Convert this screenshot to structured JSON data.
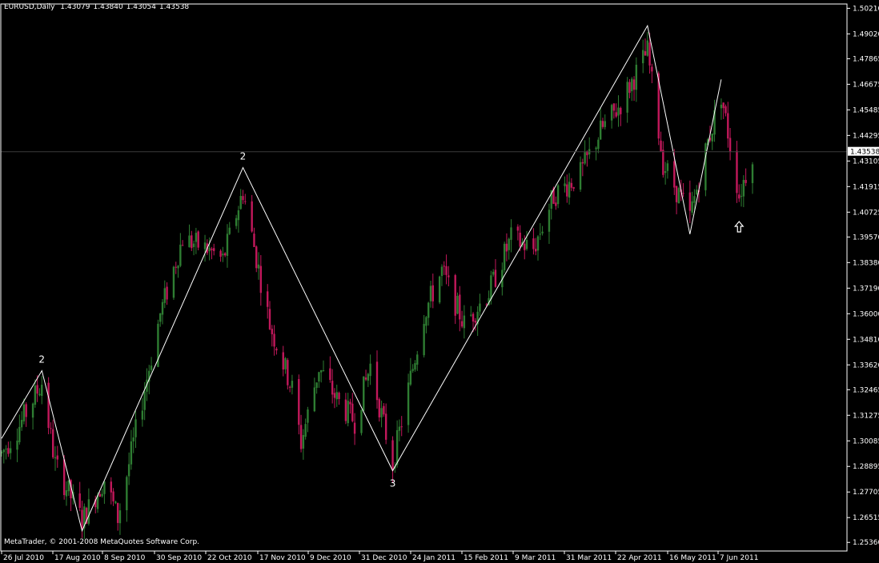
{
  "header": {
    "symbol": "EURUSD,Daily",
    "open": "1.43079",
    "high": "1.43840",
    "low": "1.43054",
    "close": "1.43538"
  },
  "copyright": "MetaTrader, © 2001-2008 MetaQuotes Software Corp.",
  "colors": {
    "background": "#000000",
    "frame": "#ffffff",
    "bull_candle": "#2e7d32",
    "bear_candle": "#c2185b",
    "wave_line": "#ffffff",
    "price_label_bg": "#ffffff"
  },
  "chart_data": {
    "type": "candlestick",
    "title": "",
    "xlabel": "",
    "ylabel": "",
    "ylim": [
      1.2496,
      1.5041
    ],
    "grid": false,
    "y_ticks": [
      "1.50210",
      "1.49020",
      "1.47865",
      "1.46675",
      "1.45485",
      "1.44295",
      "1.43105",
      "1.41915",
      "1.40725",
      "1.39570",
      "1.38380",
      "1.37190",
      "1.36000",
      "1.34810",
      "1.33620",
      "1.32465",
      "1.31275",
      "1.30085",
      "1.28895",
      "1.27705",
      "1.26515",
      "1.25360"
    ],
    "x_ticks": [
      "26 Jul 2010",
      "17 Aug 2010",
      "8 Sep 2010",
      "30 Sep 2010",
      "22 Oct 2010",
      "17 Nov 2010",
      "9 Dec 2010",
      "31 Dec 2010",
      "24 Jan 2011",
      "15 Feb 2011",
      "9 Mar 2011",
      "31 Mar 2011",
      "22 Apr 2011",
      "16 May 2011",
      "7 Jun 2011"
    ],
    "current_price": "1.43538",
    "wave_points": [
      {
        "date": "2010-07-19",
        "price": 1.302
      },
      {
        "date": "2010-08-06",
        "price": 1.3335,
        "label": "2"
      },
      {
        "date": "2010-08-24",
        "price": 1.259
      },
      {
        "date": "2010-11-04",
        "price": 1.428,
        "label": "2"
      },
      {
        "date": "2011-01-10",
        "price": 1.287,
        "label": "3"
      },
      {
        "date": "2011-05-04",
        "price": 1.494
      },
      {
        "date": "2011-05-23",
        "price": 1.397
      },
      {
        "date": "2011-06-06",
        "price": 1.469
      }
    ],
    "arrow_marker": {
      "date": "2011-06-14",
      "direction": "up"
    },
    "ohlc_anchors": [
      {
        "date": "2010-07-19",
        "price": 1.295
      },
      {
        "date": "2010-07-27",
        "price": 1.308
      },
      {
        "date": "2010-08-06",
        "price": 1.328
      },
      {
        "date": "2010-08-12",
        "price": 1.29
      },
      {
        "date": "2010-08-24",
        "price": 1.264
      },
      {
        "date": "2010-09-03",
        "price": 1.283
      },
      {
        "date": "2010-09-09",
        "price": 1.265
      },
      {
        "date": "2010-09-17",
        "price": 1.305
      },
      {
        "date": "2010-09-28",
        "price": 1.36
      },
      {
        "date": "2010-10-08",
        "price": 1.395
      },
      {
        "date": "2010-10-19",
        "price": 1.39
      },
      {
        "date": "2010-10-26",
        "price": 1.385
      },
      {
        "date": "2010-11-04",
        "price": 1.417
      },
      {
        "date": "2010-11-16",
        "price": 1.355
      },
      {
        "date": "2010-11-26",
        "price": 1.325
      },
      {
        "date": "2010-11-30",
        "price": 1.3
      },
      {
        "date": "2010-12-08",
        "price": 1.335
      },
      {
        "date": "2010-12-16",
        "price": 1.32
      },
      {
        "date": "2010-12-24",
        "price": 1.31
      },
      {
        "date": "2010-12-31",
        "price": 1.336
      },
      {
        "date": "2011-01-10",
        "price": 1.29
      },
      {
        "date": "2011-01-24",
        "price": 1.36
      },
      {
        "date": "2011-02-01",
        "price": 1.38
      },
      {
        "date": "2011-02-11",
        "price": 1.355
      },
      {
        "date": "2011-02-22",
        "price": 1.37
      },
      {
        "date": "2011-03-04",
        "price": 1.395
      },
      {
        "date": "2011-03-14",
        "price": 1.39
      },
      {
        "date": "2011-03-23",
        "price": 1.415
      },
      {
        "date": "2011-04-04",
        "price": 1.425
      },
      {
        "date": "2011-04-13",
        "price": 1.445
      },
      {
        "date": "2011-04-21",
        "price": 1.456
      },
      {
        "date": "2011-05-04",
        "price": 1.482
      },
      {
        "date": "2011-05-11",
        "price": 1.43
      },
      {
        "date": "2011-05-23",
        "price": 1.405
      },
      {
        "date": "2011-05-31",
        "price": 1.44
      },
      {
        "date": "2011-06-06",
        "price": 1.462
      },
      {
        "date": "2011-06-14",
        "price": 1.415
      },
      {
        "date": "2011-06-20",
        "price": 1.4354
      }
    ]
  }
}
